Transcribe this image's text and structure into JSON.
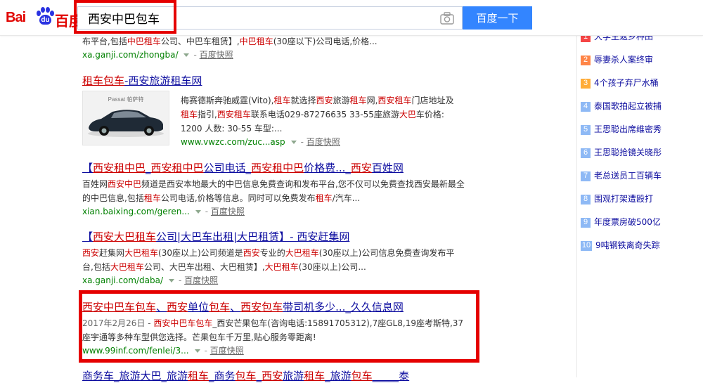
{
  "brand": {
    "logo_text_en": "Bai",
    "logo_paw_text": "du",
    "logo_text_cn": "百度"
  },
  "search": {
    "query": "西安中巴包车",
    "button_label": "百度一下"
  },
  "colors": {
    "brand_red": "#e10602",
    "brand_blue": "#2932e1",
    "button_blue": "#3385ff",
    "highlight_red": "#e50000",
    "link_blue": "#0c0c9f",
    "url_green": "#008000"
  },
  "results": [
    {
      "title": "",
      "abstract_html": "布平台,包括<em>中巴租车</em>公司、中巴车租赁】,<em>中巴租车</em>(30座以下)公司电话,价格...",
      "url": "xa.ganji.com/zhongba/",
      "snapshot": "百度快照"
    },
    {
      "title_html": "<em>租车包车</em>-西安旅游租车网",
      "abstract_html": "梅赛德斯奔驰威霆(Vito),<em>租车</em>就选择<em>西安</em>旅游<em>租车</em>网,<em>西安租车</em>门店地址及<em>租车</em>指引,<em>西安租车</em>联系电话029-87276635 33-55座旅游<em>大巴</em>车价格: 1200 人数: 30-55 车型:...",
      "url": "www.vwzc.com/zuc...asp",
      "snapshot": "百度快照",
      "thumb_caption": "Passat 帕萨特"
    },
    {
      "title_html": "【<em>西安租中巴</em>_<em>西安租中巴</em>公司电话_<em>西安租中巴</em>价格费..._<em>西安</em>百姓网",
      "abstract_html": "百姓网<em>西安中巴</em>频道是西安本地最大的中巴信息免费查询和发布平台,您不仅可以免费查找西安最新最全的中巴信息,包括<em>租车</em>公司电话,价格等信息。同时可以免费发布<em>租车</em>/汽车...",
      "url": "xian.baixing.com/geren...",
      "snapshot": "百度快照"
    },
    {
      "title_html": "【<em>西安大巴租车</em>公司|大巴车出租|大巴租赁】- 西安赶集网",
      "abstract_html": "<em>西安</em>赶集网<em>大巴租车</em>(30座以上)公司频道是<em>西安</em>专业的<em>大巴租车</em>(30座以上)公司信息免费查询发布平台,包括<em>大巴租车</em>公司、大巴车出租、大巴租赁】,<em>大巴租车</em>(30座以上)公司...",
      "url": "xa.ganji.com/daba/",
      "snapshot": "百度快照"
    },
    {
      "title_html": "<em>西安中巴车包车</em>、<em>西安</em>单位<em>包车</em>、<em>西安包车</em>带司机多少..._久久信息网",
      "abstract_html": "<span style=\"color:#666\">2017年2月26日 - </span><em>西安中巴车包车</em>_西安芒果包车(咨询电话:15891705312),7座GL8,19座考斯特,37座宇通等多种车型供您选择。芒果包车千万里,贴心服务零距离!",
      "url": "www.99inf.com/fenlei/3...",
      "snapshot": "百度快照"
    },
    {
      "title_html": "商务车_旅游大巴_旅游<em>租车</em>_商务<em>包车</em>_<em>西安</em>旅游<em>租车</em>_旅游<em>包车</em>_____泰"
    }
  ],
  "hot_list": [
    {
      "rank": "1",
      "text": "大学生返乡种田"
    },
    {
      "rank": "2",
      "text": "辱妻杀人案终审"
    },
    {
      "rank": "3",
      "text": "4个孩子弃尸水桶"
    },
    {
      "rank": "4",
      "text": "泰国歌拍起立被捕"
    },
    {
      "rank": "5",
      "text": "王思聪出席维密秀"
    },
    {
      "rank": "6",
      "text": "王思聪抢镜关晓彤"
    },
    {
      "rank": "7",
      "text": "老总送员工百辆车"
    },
    {
      "rank": "8",
      "text": "围观打架遭殴打"
    },
    {
      "rank": "9",
      "text": "年度票房破500亿"
    },
    {
      "rank": "10",
      "text": "9吨钢铁离奇失踪"
    }
  ]
}
